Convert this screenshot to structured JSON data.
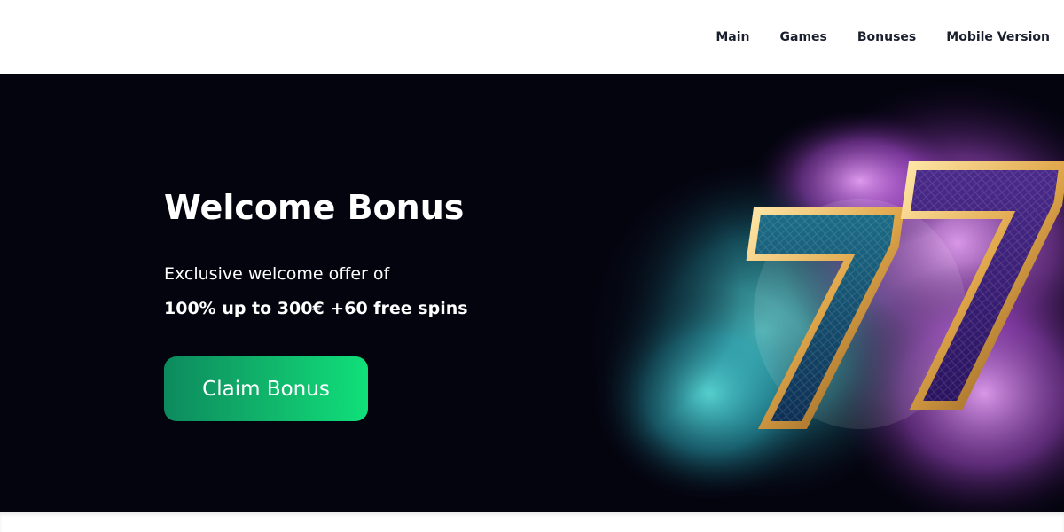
{
  "nav": {
    "items": [
      {
        "label": "Main"
      },
      {
        "label": "Games"
      },
      {
        "label": "Bonuses"
      },
      {
        "label": "Mobile Version"
      }
    ]
  },
  "hero": {
    "title": "Welcome Bonus",
    "description": "Exclusive welcome offer of",
    "offer": "100% up to 300€ +60 free spins",
    "cta_label": "Claim Bonus",
    "art_icon": "lucky-sevens-illustration"
  },
  "colors": {
    "hero_background": "#04040f",
    "cta_gradient_start": "#0d8a5e",
    "cta_gradient_end": "#10e07a",
    "nav_text": "#1a1f2e",
    "smoke_cyan": "#3fd6d6",
    "smoke_purple": "#b04fd9",
    "seven_gold": "#e0a64a"
  }
}
